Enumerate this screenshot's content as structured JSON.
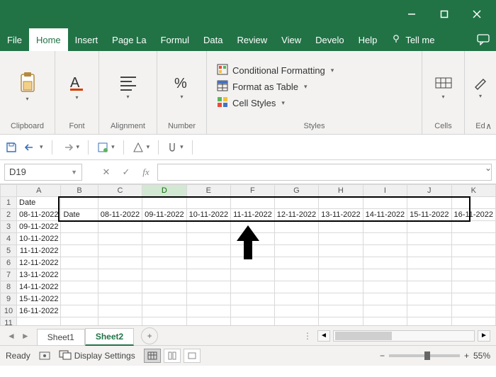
{
  "titlebar": {
    "minimize": "minimize",
    "maximize": "maximize",
    "close": "close"
  },
  "tabs": {
    "file": "File",
    "home": "Home",
    "insert": "Insert",
    "pagelayout": "Page La",
    "formulas": "Formul",
    "data": "Data",
    "review": "Review",
    "view": "View",
    "developer": "Develo",
    "help": "Help",
    "tellme": "Tell me"
  },
  "ribbon": {
    "clipboard": {
      "label": "Clipboard",
      "button": ""
    },
    "font": {
      "label": "Font"
    },
    "alignment": {
      "label": "Alignment"
    },
    "number": {
      "label": "Number"
    },
    "styles": {
      "label": "Styles",
      "cond": "Conditional Formatting",
      "table": "Format as Table",
      "cell": "Cell Styles"
    },
    "cells": {
      "label": "Cells"
    },
    "editing": {
      "label": "Ed"
    }
  },
  "formula": {
    "namebox": "D19",
    "fx": "fx",
    "value": ""
  },
  "grid": {
    "cols": [
      "A",
      "B",
      "C",
      "D",
      "E",
      "F",
      "G",
      "H",
      "I",
      "J",
      "K"
    ],
    "rowhead": [
      "1",
      "2",
      "3",
      "4",
      "5",
      "6",
      "7",
      "8",
      "9",
      "10",
      "11"
    ],
    "a": [
      "Date",
      "08-11-2022",
      "09-11-2022",
      "10-11-2022",
      "11-11-2022",
      "12-11-2022",
      "13-11-2022",
      "14-11-2022",
      "15-11-2022",
      "16-11-2022",
      ""
    ],
    "row2": [
      "Date",
      "08-11-2022",
      "09-11-2022",
      "10-11-2022",
      "11-11-2022",
      "12-11-2022",
      "13-11-2022",
      "14-11-2022",
      "15-11-2022",
      "16-11-2022"
    ]
  },
  "sheets": {
    "s1": "Sheet1",
    "s2": "Sheet2"
  },
  "status": {
    "ready": "Ready",
    "display": "Display Settings",
    "zoom": "55%"
  }
}
